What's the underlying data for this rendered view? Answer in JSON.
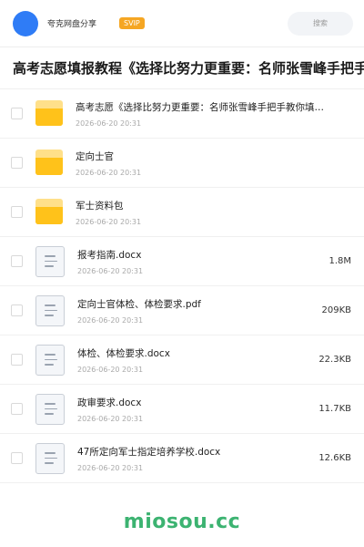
{
  "header": {
    "user_name": "夸克网盘分享",
    "badge": "SVIP",
    "search_placeholder": "搜索"
  },
  "page_title": "高考志愿填报教程《选择比努力更重要：名师张雪峰手把手",
  "files": [
    {
      "name": "高考志愿《选择比努力更重要：名师张雪峰手把手教你填…",
      "date": "2026-06-20 20:31",
      "size": "",
      "icon": "folder-icon"
    },
    {
      "name": "定向士官",
      "date": "2026-06-20 20:31",
      "size": "",
      "icon": "folder-icon"
    },
    {
      "name": "军士资料包",
      "date": "2026-06-20 20:31",
      "size": "",
      "icon": "folder-icon"
    },
    {
      "name": "报考指南.docx",
      "date": "2026-06-20 20:31",
      "size": "1.8M",
      "icon": "document-icon"
    },
    {
      "name": "定向士官体检、体检要求.pdf",
      "date": "2026-06-20 20:31",
      "size": "209KB",
      "icon": "document-icon"
    },
    {
      "name": "体检、体检要求.docx",
      "date": "2026-06-20 20:31",
      "size": "22.3KB",
      "icon": "document-icon"
    },
    {
      "name": "政审要求.docx",
      "date": "2026-06-20 20:31",
      "size": "11.7KB",
      "icon": "document-icon"
    },
    {
      "name": "47所定向军士指定培养学校.docx",
      "date": "2026-06-20 20:31",
      "size": "12.6KB",
      "icon": "document-icon"
    }
  ],
  "watermark": "miosou.cc",
  "colors": {
    "avatar": "#2f7cf6",
    "svip_badge": "#f5a623",
    "folder": "#ffc21a",
    "watermark": "#3cb371"
  }
}
